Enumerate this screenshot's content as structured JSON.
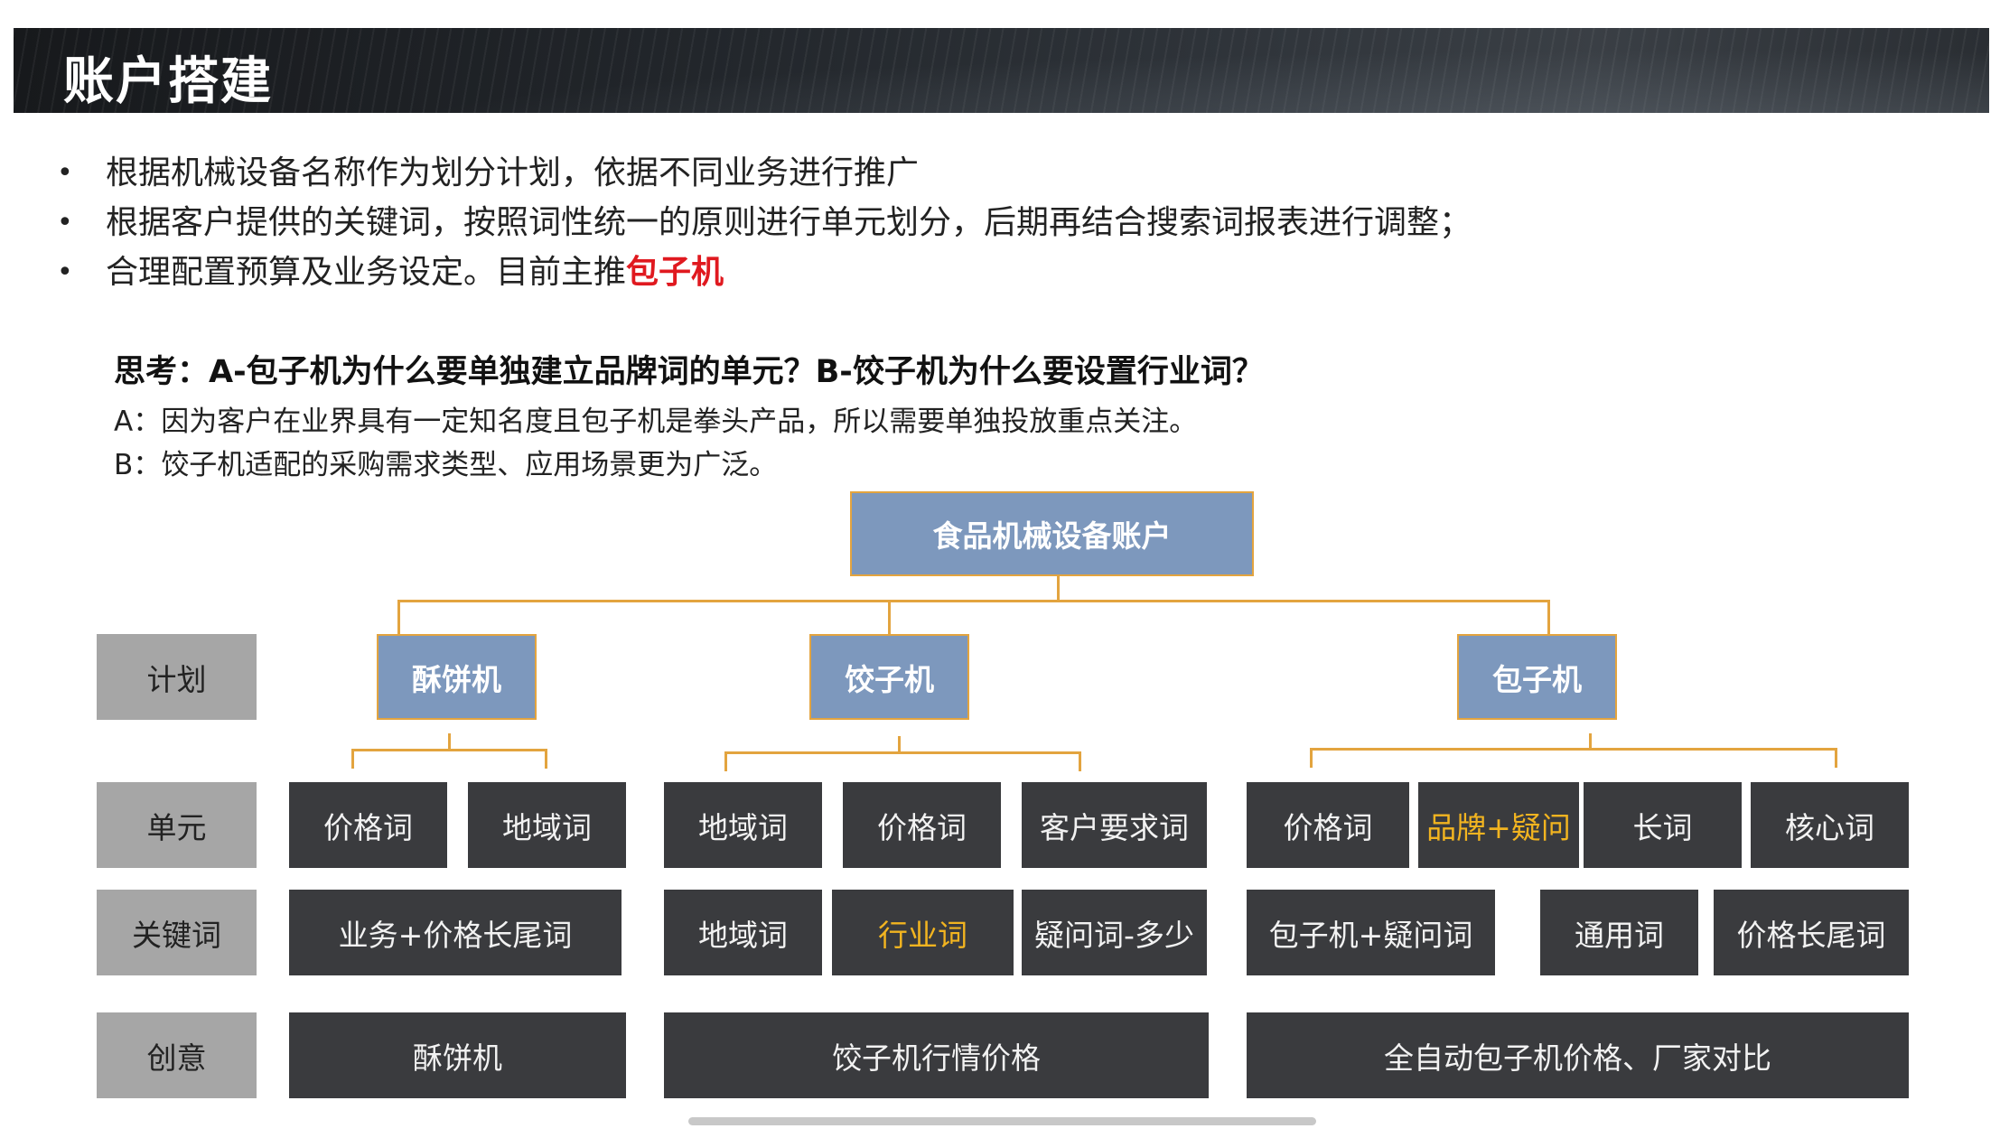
{
  "header": {
    "title": "账户搭建"
  },
  "bullets": [
    {
      "text": "根据机械设备名称作为划分计划，依据不同业务进行推广",
      "highlight": ""
    },
    {
      "text": "根据客户提供的关键词，按照词性统一的原则进行单元划分，后期再结合搜索词报表进行调整；",
      "highlight": ""
    },
    {
      "text": "合理配置预算及业务设定。目前主推",
      "highlight": "包子机"
    }
  ],
  "bullet_symbol": "•",
  "thinking": {
    "question": "思考：A-包子机为什么要单独建立品牌词的单元？B-饺子机为什么要设置行业词？",
    "answer_a": "A：因为客户在业界具有一定知名度且包子机是拳头产品，所以需要单独投放重点关注。",
    "answer_b": "B：饺子机适配的采购需求类型、应用场景更为广泛。"
  },
  "diagram": {
    "root": "食品机械设备账户",
    "row_labels": {
      "plan": "计划",
      "unit": "单元",
      "keyword": "关键词",
      "creative": "创意"
    },
    "plans": [
      "酥饼机",
      "饺子机",
      "包子机"
    ],
    "units": {
      "subing": [
        "价格词",
        "地域词"
      ],
      "jiaozi": [
        "地域词",
        "价格词",
        "客户要求词"
      ],
      "baozi": [
        "价格词",
        "品牌+疑问",
        "长词",
        "核心词"
      ]
    },
    "keywords": {
      "subing": [
        "业务+价格长尾词"
      ],
      "jiaozi": [
        "地域词",
        "行业词",
        "疑问词-多少"
      ],
      "baozi": [
        "包子机+疑问词",
        "通用词",
        "价格长尾词"
      ]
    },
    "creatives": [
      "酥饼机",
      "饺子机行情价格",
      "全自动包子机价格、厂家对比"
    ],
    "highlight_color": "#f2b420",
    "line_color": "#e3a43f",
    "box_color": "#7d98bd"
  }
}
